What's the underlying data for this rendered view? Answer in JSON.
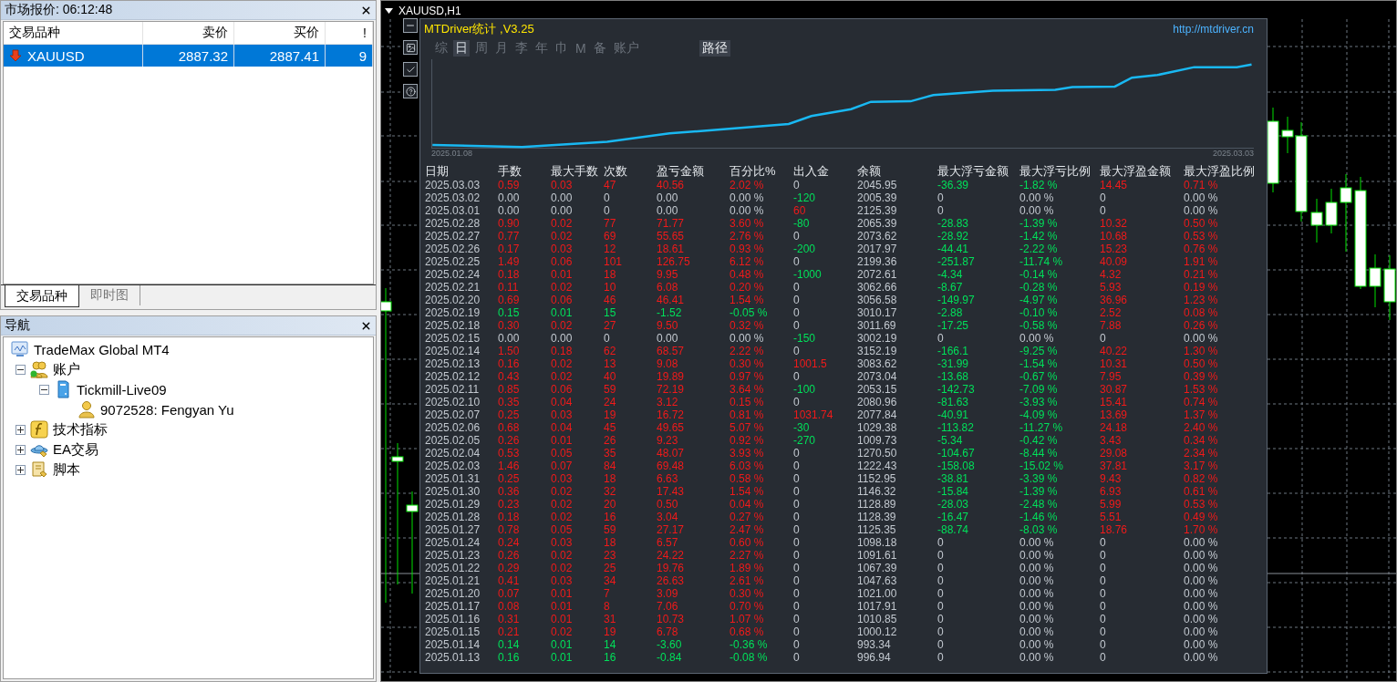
{
  "market_watch": {
    "title": "市场报价: 06:12:48",
    "columns": [
      "交易品种",
      "卖价",
      "买价",
      "!"
    ],
    "rows": [
      {
        "symbol": "XAUUSD",
        "bid": "2887.32",
        "ask": "2887.41",
        "spread": "9",
        "selected": true
      }
    ],
    "tabs": [
      {
        "label": "交易品种",
        "selected": true
      },
      {
        "label": "即时图",
        "selected": false
      }
    ]
  },
  "navigator": {
    "title": "导航",
    "tree": [
      {
        "label": "TradeMax Global MT4",
        "kind": "terminal",
        "children": [
          {
            "label": "账户",
            "kind": "accounts",
            "expanded": true,
            "children": [
              {
                "label": "Tickmill-Live09",
                "kind": "server",
                "expanded": true,
                "children": [
                  {
                    "label": "9072528: Fengyan Yu",
                    "kind": "user"
                  }
                ]
              }
            ]
          },
          {
            "label": "技术指标",
            "kind": "indicators",
            "expanded": false
          },
          {
            "label": "EA交易",
            "kind": "experts",
            "expanded": false
          },
          {
            "label": "脚本",
            "kind": "scripts",
            "expanded": false
          }
        ]
      }
    ]
  },
  "chart": {
    "title": "XAUUSD,H1",
    "panel": {
      "title": "MTDriver统计 ,V3.25",
      "link": "http://mtdriver.cn",
      "periods": [
        {
          "label": "综",
          "selected": false
        },
        {
          "label": "日",
          "selected": true
        },
        {
          "label": "周",
          "selected": false
        },
        {
          "label": "月",
          "selected": false
        },
        {
          "label": "李",
          "selected": false
        },
        {
          "label": "年",
          "selected": false
        },
        {
          "label": "巾",
          "selected": false
        },
        {
          "label": "M",
          "selected": false
        },
        {
          "label": "备",
          "selected": false
        },
        {
          "label": "账户",
          "selected": false
        }
      ],
      "path_button": "路径",
      "curve": {
        "start_label": "2025.01.08",
        "end_label": "2025.03.03"
      },
      "columns": [
        "日期",
        "手数",
        "最大手数",
        "次数",
        "盈亏金额",
        "百分比%",
        "出入金",
        "余额",
        "最大浮亏金额",
        "最大浮亏比例",
        "最大浮盈金额",
        "最大浮盈比例"
      ],
      "rows": [
        {
          "cells": [
            "2025.03.03",
            "0.59",
            "0.03",
            "47",
            "40.56",
            "2.02 %",
            "0",
            "2045.95",
            "-36.39",
            "-1.82 %",
            "14.45",
            "0.71 %"
          ],
          "kind": "gain",
          "deposit": false,
          "withdrawal": false,
          "floating": true
        },
        {
          "cells": [
            "2025.03.02",
            "0.00",
            "0.00",
            "0",
            "0.00",
            "0.00 %",
            "-120",
            "2005.39",
            "0",
            "0.00 %",
            "0",
            "0.00 %"
          ],
          "kind": "flat",
          "deposit": false,
          "withdrawal": true,
          "floating": false
        },
        {
          "cells": [
            "2025.03.01",
            "0.00",
            "0.00",
            "0",
            "0.00",
            "0.00 %",
            "60",
            "2125.39",
            "0",
            "0.00 %",
            "0",
            "0.00 %"
          ],
          "kind": "flat",
          "deposit": true,
          "withdrawal": false,
          "floating": false
        },
        {
          "cells": [
            "2025.02.28",
            "0.90",
            "0.02",
            "77",
            "71.77",
            "3.60 %",
            "-80",
            "2065.39",
            "-28.83",
            "-1.39 %",
            "10.32",
            "0.50 %"
          ],
          "kind": "gain",
          "deposit": false,
          "withdrawal": true,
          "floating": true
        },
        {
          "cells": [
            "2025.02.27",
            "0.77",
            "0.02",
            "69",
            "55.65",
            "2.76 %",
            "0",
            "2073.62",
            "-28.92",
            "-1.42 %",
            "10.68",
            "0.53 %"
          ],
          "kind": "gain",
          "deposit": false,
          "withdrawal": false,
          "floating": true
        },
        {
          "cells": [
            "2025.02.26",
            "0.17",
            "0.03",
            "12",
            "18.61",
            "0.93 %",
            "-200",
            "2017.97",
            "-44.41",
            "-2.22 %",
            "15.23",
            "0.76 %"
          ],
          "kind": "gain",
          "deposit": false,
          "withdrawal": true,
          "floating": true
        },
        {
          "cells": [
            "2025.02.25",
            "1.49",
            "0.06",
            "101",
            "126.75",
            "6.12 %",
            "0",
            "2199.36",
            "-251.87",
            "-11.74 %",
            "40.09",
            "1.91 %"
          ],
          "kind": "gain",
          "deposit": false,
          "withdrawal": false,
          "floating": true
        },
        {
          "cells": [
            "2025.02.24",
            "0.18",
            "0.01",
            "18",
            "9.95",
            "0.48 %",
            "-1000",
            "2072.61",
            "-4.34",
            "-0.14 %",
            "4.32",
            "0.21 %"
          ],
          "kind": "gain",
          "deposit": false,
          "withdrawal": true,
          "floating": true
        },
        {
          "cells": [
            "2025.02.21",
            "0.11",
            "0.02",
            "10",
            "6.08",
            "0.20 %",
            "0",
            "3062.66",
            "-8.67",
            "-0.28 %",
            "5.93",
            "0.19 %"
          ],
          "kind": "gain",
          "deposit": false,
          "withdrawal": false,
          "floating": true
        },
        {
          "cells": [
            "2025.02.20",
            "0.69",
            "0.06",
            "46",
            "46.41",
            "1.54 %",
            "0",
            "3056.58",
            "-149.97",
            "-4.97 %",
            "36.96",
            "1.23 %"
          ],
          "kind": "gain",
          "deposit": false,
          "withdrawal": false,
          "floating": true
        },
        {
          "cells": [
            "2025.02.19",
            "0.15",
            "0.01",
            "15",
            "-1.52",
            "-0.05 %",
            "0",
            "3010.17",
            "-2.88",
            "-0.10 %",
            "2.52",
            "0.08 %"
          ],
          "kind": "loss",
          "deposit": false,
          "withdrawal": false,
          "floating": true
        },
        {
          "cells": [
            "2025.02.18",
            "0.30",
            "0.02",
            "27",
            "9.50",
            "0.32 %",
            "0",
            "3011.69",
            "-17.25",
            "-0.58 %",
            "7.88",
            "0.26 %"
          ],
          "kind": "gain",
          "deposit": false,
          "withdrawal": false,
          "floating": true
        },
        {
          "cells": [
            "2025.02.15",
            "0.00",
            "0.00",
            "0",
            "0.00",
            "0.00 %",
            "-150",
            "3002.19",
            "0",
            "0.00 %",
            "0",
            "0.00 %"
          ],
          "kind": "flat",
          "deposit": false,
          "withdrawal": true,
          "floating": false
        },
        {
          "cells": [
            "2025.02.14",
            "1.50",
            "0.18",
            "62",
            "68.57",
            "2.22 %",
            "0",
            "3152.19",
            "-166.1",
            "-9.25 %",
            "40.22",
            "1.30 %"
          ],
          "kind": "gain",
          "deposit": false,
          "withdrawal": false,
          "floating": true
        },
        {
          "cells": [
            "2025.02.13",
            "0.16",
            "0.02",
            "13",
            "9.08",
            "0.30 %",
            "1001.5",
            "3083.62",
            "-31.99",
            "-1.54 %",
            "10.31",
            "0.50 %"
          ],
          "kind": "gain",
          "deposit": true,
          "withdrawal": false,
          "floating": true
        },
        {
          "cells": [
            "2025.02.12",
            "0.43",
            "0.02",
            "40",
            "19.89",
            "0.97 %",
            "0",
            "2073.04",
            "-13.68",
            "-0.67 %",
            "7.95",
            "0.39 %"
          ],
          "kind": "gain",
          "deposit": false,
          "withdrawal": false,
          "floating": true
        },
        {
          "cells": [
            "2025.02.11",
            "0.85",
            "0.06",
            "59",
            "72.19",
            "3.64 %",
            "-100",
            "2053.15",
            "-142.73",
            "-7.09 %",
            "30.87",
            "1.53 %"
          ],
          "kind": "gain",
          "deposit": false,
          "withdrawal": true,
          "floating": true
        },
        {
          "cells": [
            "2025.02.10",
            "0.35",
            "0.04",
            "24",
            "3.12",
            "0.15 %",
            "0",
            "2080.96",
            "-81.63",
            "-3.93 %",
            "15.41",
            "0.74 %"
          ],
          "kind": "gain",
          "deposit": false,
          "withdrawal": false,
          "floating": true
        },
        {
          "cells": [
            "2025.02.07",
            "0.25",
            "0.03",
            "19",
            "16.72",
            "0.81 %",
            "1031.74",
            "2077.84",
            "-40.91",
            "-4.09 %",
            "13.69",
            "1.37 %"
          ],
          "kind": "gain",
          "deposit": true,
          "withdrawal": false,
          "floating": true
        },
        {
          "cells": [
            "2025.02.06",
            "0.68",
            "0.04",
            "45",
            "49.65",
            "5.07 %",
            "-30",
            "1029.38",
            "-113.82",
            "-11.27 %",
            "24.18",
            "2.40 %"
          ],
          "kind": "gain",
          "deposit": false,
          "withdrawal": true,
          "floating": true
        },
        {
          "cells": [
            "2025.02.05",
            "0.26",
            "0.01",
            "26",
            "9.23",
            "0.92 %",
            "-270",
            "1009.73",
            "-5.34",
            "-0.42 %",
            "3.43",
            "0.34 %"
          ],
          "kind": "gain",
          "deposit": false,
          "withdrawal": true,
          "floating": true
        },
        {
          "cells": [
            "2025.02.04",
            "0.53",
            "0.05",
            "35",
            "48.07",
            "3.93 %",
            "0",
            "1270.50",
            "-104.67",
            "-8.44 %",
            "29.08",
            "2.34 %"
          ],
          "kind": "gain",
          "deposit": false,
          "withdrawal": false,
          "floating": true
        },
        {
          "cells": [
            "2025.02.03",
            "1.46",
            "0.07",
            "84",
            "69.48",
            "6.03 %",
            "0",
            "1222.43",
            "-158.08",
            "-15.02 %",
            "37.81",
            "3.17 %"
          ],
          "kind": "gain",
          "deposit": false,
          "withdrawal": false,
          "floating": true
        },
        {
          "cells": [
            "2025.01.31",
            "0.25",
            "0.03",
            "18",
            "6.63",
            "0.58 %",
            "0",
            "1152.95",
            "-38.81",
            "-3.39 %",
            "9.43",
            "0.82 %"
          ],
          "kind": "gain",
          "deposit": false,
          "withdrawal": false,
          "floating": true
        },
        {
          "cells": [
            "2025.01.30",
            "0.36",
            "0.02",
            "32",
            "17.43",
            "1.54 %",
            "0",
            "1146.32",
            "-15.84",
            "-1.39 %",
            "6.93",
            "0.61 %"
          ],
          "kind": "gain",
          "deposit": false,
          "withdrawal": false,
          "floating": true
        },
        {
          "cells": [
            "2025.01.29",
            "0.23",
            "0.02",
            "20",
            "0.50",
            "0.04 %",
            "0",
            "1128.89",
            "-28.03",
            "-2.48 %",
            "5.99",
            "0.53 %"
          ],
          "kind": "gain",
          "deposit": false,
          "withdrawal": false,
          "floating": true
        },
        {
          "cells": [
            "2025.01.28",
            "0.18",
            "0.02",
            "16",
            "3.04",
            "0.27 %",
            "0",
            "1128.39",
            "-16.47",
            "-1.46 %",
            "5.51",
            "0.49 %"
          ],
          "kind": "gain",
          "deposit": false,
          "withdrawal": false,
          "floating": true
        },
        {
          "cells": [
            "2025.01.27",
            "0.78",
            "0.05",
            "59",
            "27.17",
            "2.47 %",
            "0",
            "1125.35",
            "-88.74",
            "-8.03 %",
            "18.76",
            "1.70 %"
          ],
          "kind": "gain",
          "deposit": false,
          "withdrawal": false,
          "floating": true
        },
        {
          "cells": [
            "2025.01.24",
            "0.24",
            "0.03",
            "18",
            "6.57",
            "0.60 %",
            "0",
            "1098.18",
            "0",
            "0.00 %",
            "0",
            "0.00 %"
          ],
          "kind": "gain",
          "deposit": false,
          "withdrawal": false,
          "floating": false
        },
        {
          "cells": [
            "2025.01.23",
            "0.26",
            "0.02",
            "23",
            "24.22",
            "2.27 %",
            "0",
            "1091.61",
            "0",
            "0.00 %",
            "0",
            "0.00 %"
          ],
          "kind": "gain",
          "deposit": false,
          "withdrawal": false,
          "floating": false
        },
        {
          "cells": [
            "2025.01.22",
            "0.29",
            "0.02",
            "25",
            "19.76",
            "1.89 %",
            "0",
            "1067.39",
            "0",
            "0.00 %",
            "0",
            "0.00 %"
          ],
          "kind": "gain",
          "deposit": false,
          "withdrawal": false,
          "floating": false
        },
        {
          "cells": [
            "2025.01.21",
            "0.41",
            "0.03",
            "34",
            "26.63",
            "2.61 %",
            "0",
            "1047.63",
            "0",
            "0.00 %",
            "0",
            "0.00 %"
          ],
          "kind": "gain",
          "deposit": false,
          "withdrawal": false,
          "floating": false
        },
        {
          "cells": [
            "2025.01.20",
            "0.07",
            "0.01",
            "7",
            "3.09",
            "0.30 %",
            "0",
            "1021.00",
            "0",
            "0.00 %",
            "0",
            "0.00 %"
          ],
          "kind": "gain",
          "deposit": false,
          "withdrawal": false,
          "floating": false
        },
        {
          "cells": [
            "2025.01.17",
            "0.08",
            "0.01",
            "8",
            "7.06",
            "0.70 %",
            "0",
            "1017.91",
            "0",
            "0.00 %",
            "0",
            "0.00 %"
          ],
          "kind": "gain",
          "deposit": false,
          "withdrawal": false,
          "floating": false
        },
        {
          "cells": [
            "2025.01.16",
            "0.31",
            "0.01",
            "31",
            "10.73",
            "1.07 %",
            "0",
            "1010.85",
            "0",
            "0.00 %",
            "0",
            "0.00 %"
          ],
          "kind": "gain",
          "deposit": false,
          "withdrawal": false,
          "floating": false
        },
        {
          "cells": [
            "2025.01.15",
            "0.21",
            "0.02",
            "19",
            "6.78",
            "0.68 %",
            "0",
            "1000.12",
            "0",
            "0.00 %",
            "0",
            "0.00 %"
          ],
          "kind": "gain",
          "deposit": false,
          "withdrawal": false,
          "floating": false
        },
        {
          "cells": [
            "2025.01.14",
            "0.14",
            "0.01",
            "14",
            "-3.60",
            "-0.36 %",
            "0",
            "993.34",
            "0",
            "0.00 %",
            "0",
            "0.00 %"
          ],
          "kind": "loss",
          "deposit": false,
          "withdrawal": false,
          "floating": false
        },
        {
          "cells": [
            "2025.01.13",
            "0.16",
            "0.01",
            "16",
            "-0.84",
            "-0.08 %",
            "0",
            "996.94",
            "0",
            "0.00 %",
            "0",
            "0.00 %"
          ],
          "kind": "loss",
          "deposit": false,
          "withdrawal": false,
          "floating": false
        }
      ]
    }
  }
}
